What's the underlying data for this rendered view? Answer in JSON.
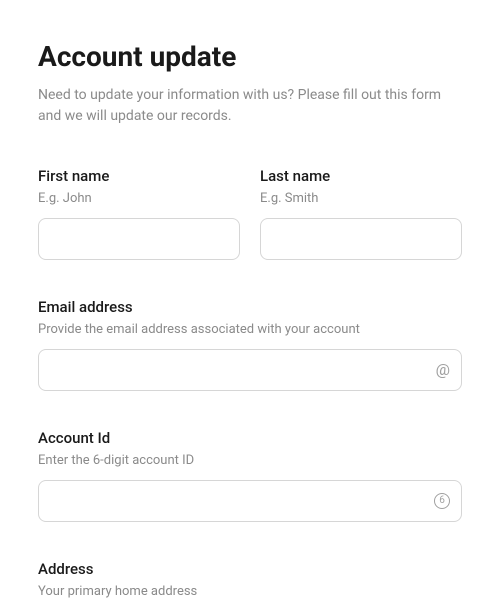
{
  "header": {
    "title": "Account update",
    "description": "Need to update your information with us? Please fill out this form and we will update our records."
  },
  "fields": {
    "first_name": {
      "label": "First name",
      "hint": "E.g. John",
      "value": ""
    },
    "last_name": {
      "label": "Last name",
      "hint": "E.g. Smith",
      "value": ""
    },
    "email": {
      "label": "Email address",
      "hint": "Provide the email address associated with your account",
      "value": "",
      "icon": "at-icon"
    },
    "account_id": {
      "label": "Account Id",
      "hint": "Enter the 6-digit account ID",
      "value": "",
      "icon": "six-circle-icon",
      "icon_text": "6"
    },
    "address": {
      "label": "Address",
      "hint": "Your primary home address",
      "value": ""
    }
  }
}
